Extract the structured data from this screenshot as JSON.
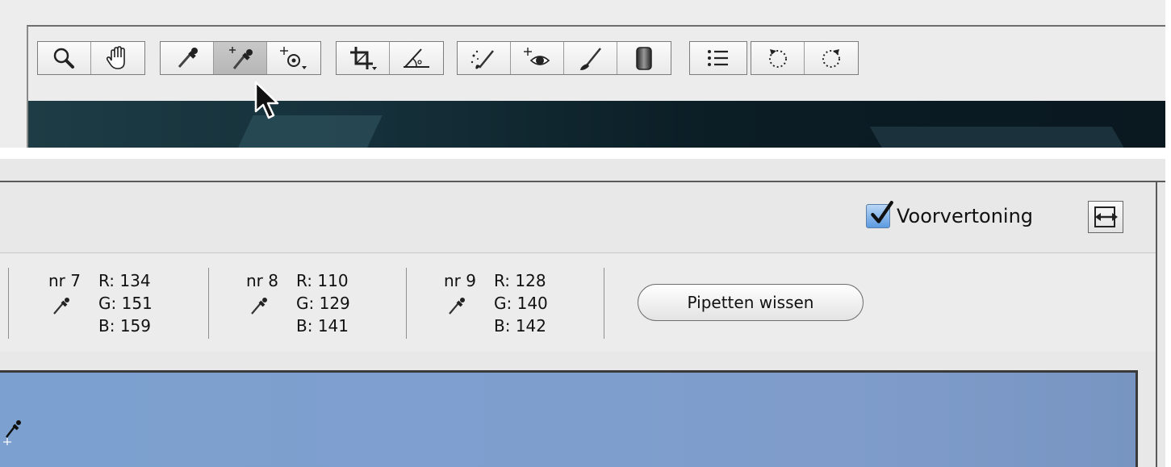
{
  "toolbar": {
    "tools": [
      {
        "name": "zoom-tool",
        "icon": "magnifier-icon"
      },
      {
        "name": "hand-tool",
        "icon": "hand-icon"
      },
      {
        "name": "white-balance-tool",
        "icon": "eyedropper-icon"
      },
      {
        "name": "color-sampler-tool",
        "icon": "color-sampler-icon",
        "active": true
      },
      {
        "name": "targeted-adjustment-tool",
        "icon": "target-adjust-icon"
      },
      {
        "name": "crop-tool",
        "icon": "crop-icon"
      },
      {
        "name": "straighten-tool",
        "icon": "straighten-icon"
      },
      {
        "name": "spot-removal-tool",
        "icon": "spot-removal-icon"
      },
      {
        "name": "red-eye-tool",
        "icon": "red-eye-icon"
      },
      {
        "name": "adjustment-brush-tool",
        "icon": "brush-icon"
      },
      {
        "name": "graduated-filter-tool",
        "icon": "gradient-icon"
      },
      {
        "name": "preferences-tool",
        "icon": "list-icon"
      },
      {
        "name": "rotate-left-tool",
        "icon": "rotate-ccw-icon"
      },
      {
        "name": "rotate-right-tool",
        "icon": "rotate-cw-icon"
      }
    ]
  },
  "preview": {
    "label": "Voorvertoning",
    "checked": true,
    "toggle_icon": "before-after-toggle-icon"
  },
  "samplers": [
    {
      "nr": "nr 7",
      "r": "R: 134",
      "g": "G: 151",
      "b": "B: 159"
    },
    {
      "nr": "nr 8",
      "r": "R: 110",
      "g": "G: 129",
      "b": "B: 141"
    },
    {
      "nr": "nr 9",
      "r": "R: 128",
      "g": "G: 140",
      "b": "B: 142"
    }
  ],
  "clear_button": {
    "label": "Pipetten wissen"
  },
  "colors": {
    "accent_check": "#4a8fe0",
    "image_sky": "#7c9fcf",
    "top_image_dark": "#12303a"
  }
}
